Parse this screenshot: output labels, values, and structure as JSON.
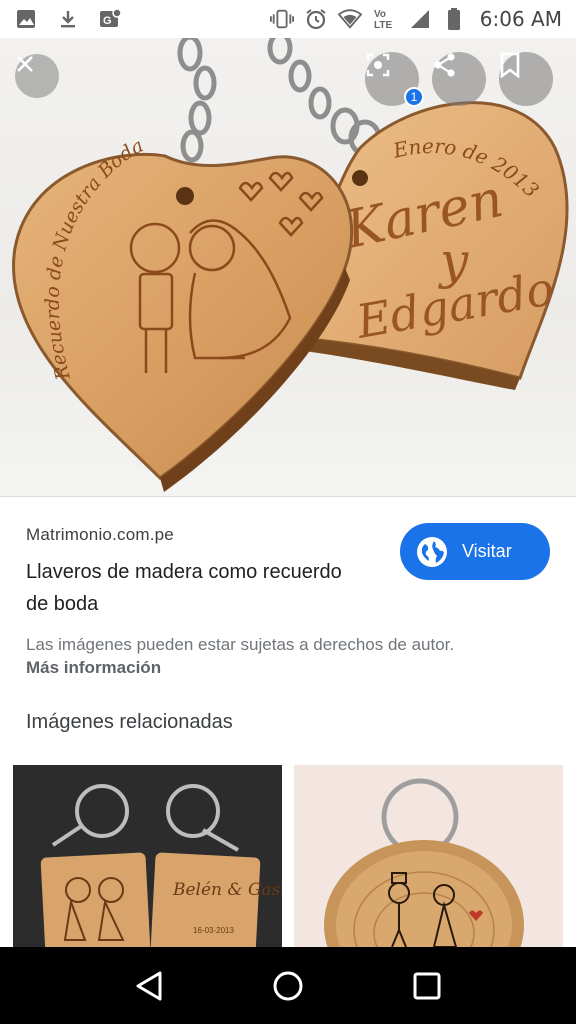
{
  "status_bar": {
    "time": "6:06 AM",
    "volte_label": "Vo LTE",
    "left_icons": [
      "image-icon",
      "download-icon",
      "google-photos-icon"
    ],
    "right_icons": [
      "vibrate-icon",
      "alarm-icon",
      "wifi-icon",
      "volte-icon",
      "signal-icon",
      "battery-icon"
    ]
  },
  "hero": {
    "close_icon": "close-icon",
    "lens_icon": "lens-icon",
    "lens_badge": "1",
    "share_icon": "share-icon",
    "save_icon": "bookmark-icon",
    "left_heart_text": "Recuerdo de Nuestra Boda",
    "right_heart_top": "Enero de 2013",
    "right_heart_name1": "Karen",
    "right_heart_y": "y",
    "right_heart_name2": "Edgardo"
  },
  "result": {
    "source": "Matrimonio.com.pe",
    "title": "Llaveros de madera como recuerdo de boda",
    "visit_label": "Visitar",
    "copyright": "Las imágenes pueden estar sujetas a derechos de autor.",
    "more_info": "Más información"
  },
  "related": {
    "title": "Imágenes relacionadas",
    "thumb1_names": "Belén & Gastón",
    "thumb1_date": "16-03-2013"
  },
  "nav": {
    "back_icon": "back-icon",
    "home_icon": "home-icon",
    "recents_icon": "recents-icon"
  },
  "colors": {
    "accent": "#1a73e8",
    "wood": "#d9a46b"
  }
}
